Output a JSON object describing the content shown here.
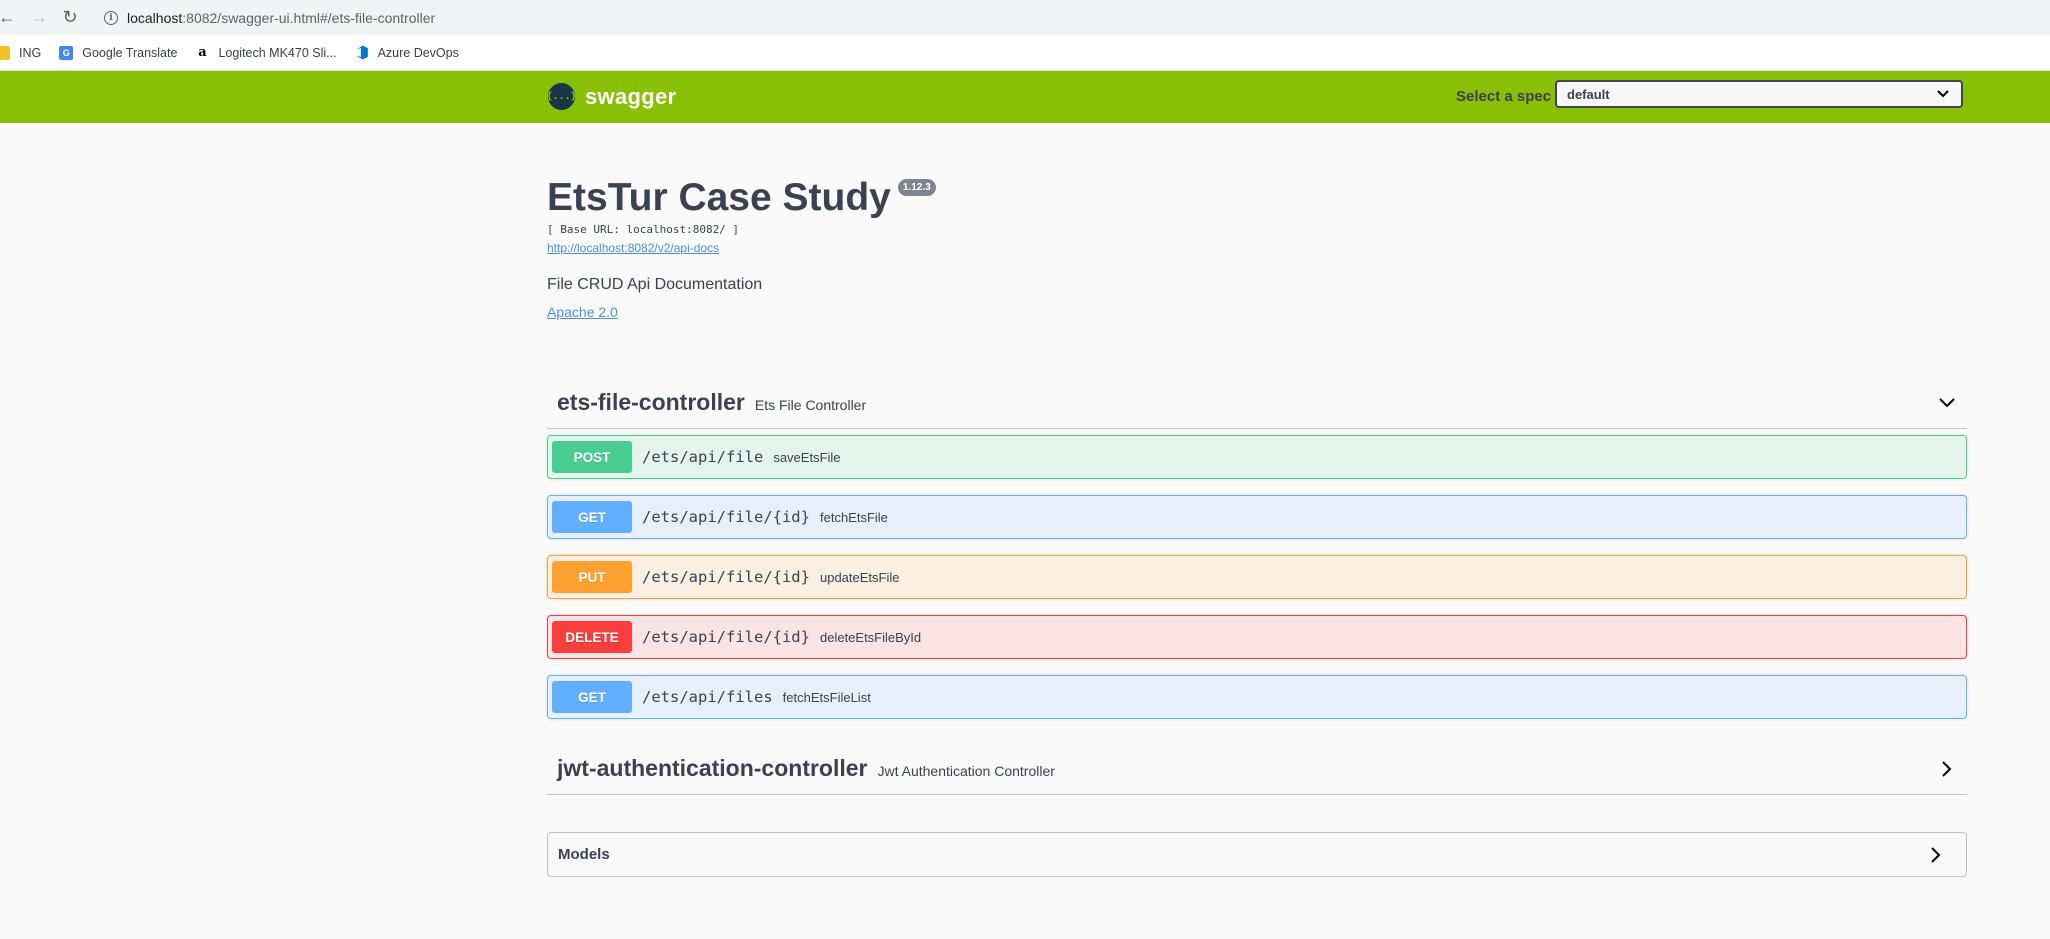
{
  "browser": {
    "url_host": "localhost",
    "url_rest": ":8082/swagger-ui.html#/ets-file-controller",
    "bookmarks": [
      {
        "label": "ING",
        "icon": "folder-icon"
      },
      {
        "label": "Google Translate",
        "icon": "google-translate-icon"
      },
      {
        "label": "Logitech MK470 Sli...",
        "icon": "amazon-icon"
      },
      {
        "label": "Azure DevOps",
        "icon": "azure-devops-icon"
      }
    ]
  },
  "topbar": {
    "logo_text": "swagger",
    "logo_glyph": "{...}",
    "spec_label": "Select a spec",
    "spec_value": "default",
    "color": "#89bf04"
  },
  "info": {
    "title": "EtsTur Case Study",
    "version": "1.12.3",
    "base_url": "[ Base URL: localhost:8082/ ]",
    "spec_link": "http://localhost:8082/v2/api-docs",
    "description": "File CRUD Api Documentation",
    "license": "Apache 2.0"
  },
  "tags": [
    {
      "name": "ets-file-controller",
      "description": "Ets File Controller",
      "expanded": true,
      "operations": [
        {
          "method": "POST",
          "path": "/ets/api/file",
          "summary": "saveEtsFile"
        },
        {
          "method": "GET",
          "path": "/ets/api/file/{id}",
          "summary": "fetchEtsFile"
        },
        {
          "method": "PUT",
          "path": "/ets/api/file/{id}",
          "summary": "updateEtsFile"
        },
        {
          "method": "DELETE",
          "path": "/ets/api/file/{id}",
          "summary": "deleteEtsFileById"
        },
        {
          "method": "GET",
          "path": "/ets/api/files",
          "summary": "fetchEtsFileList"
        }
      ]
    },
    {
      "name": "jwt-authentication-controller",
      "description": "Jwt Authentication Controller",
      "expanded": false
    }
  ],
  "models": {
    "label": "Models"
  },
  "colors": {
    "post": "#49cc90",
    "get": "#61affe",
    "put": "#fca130",
    "delete": "#f93e3e",
    "link": "#4990e2"
  }
}
